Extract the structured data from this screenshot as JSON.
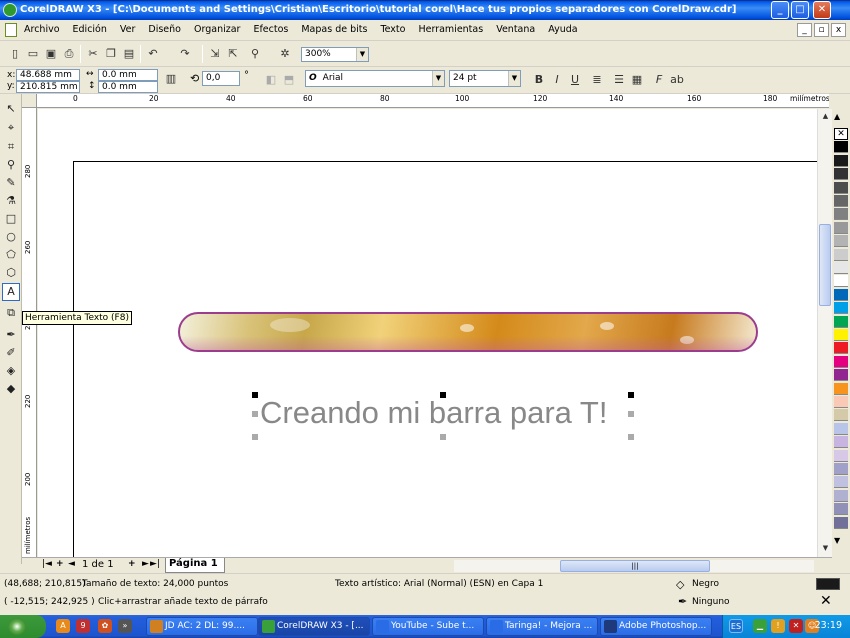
{
  "window": {
    "title": "CorelDRAW X3 - [C:\\Documents and Settings\\Cristian\\Escritorio\\tutorial corel\\Hace tus propios separadores con CorelDraw.cdr]",
    "min": "_",
    "max": "□",
    "close": "✕"
  },
  "menu": [
    "Archivo",
    "Edición",
    "Ver",
    "Diseño",
    "Organizar",
    "Efectos",
    "Mapas de bits",
    "Texto",
    "Herramientas",
    "Ventana",
    "Ayuda"
  ],
  "mdi": {
    "min": "_",
    "restore": "▫",
    "close": "x"
  },
  "standard_toolbar": {
    "zoom": "300%"
  },
  "property_bar": {
    "x_label": "x:",
    "x_value": "48.688 mm",
    "y_label": "y:",
    "y_value": "210.815 mm",
    "w_value": "0.0 mm",
    "h_value": "0.0 mm",
    "angle": "0,0",
    "degree": "°",
    "font": "Arial",
    "size": "24 pt",
    "bold": "B",
    "italic": "I",
    "underline": "U"
  },
  "ruler": {
    "h_ticks": [
      "0",
      "20",
      "40",
      "60",
      "80",
      "100",
      "120",
      "140",
      "160",
      "180"
    ],
    "h_unit": "milímetros",
    "v_ticks": [
      "280",
      "260",
      "240",
      "220",
      "200"
    ],
    "v_unit": "milímetros"
  },
  "canvas": {
    "art_text": "Creando mi barra para T!"
  },
  "tooltip": "Herramienta Texto (F8)",
  "palette": [
    "#ffffff",
    "#000000",
    "#1a1a1a",
    "#333333",
    "#4d4d4d",
    "#666666",
    "#808080",
    "#999999",
    "#b3b3b3",
    "#cccccc",
    "#e6e6e6",
    "#ffffff",
    "#0068b8",
    "#00a0e9",
    "#00a651",
    "#fff200",
    "#ed1c24",
    "#e4007f",
    "#92278f",
    "#f7941d",
    "#f9c9b6",
    "#d4c9a8",
    "#b8c4e8",
    "#c8b4e0",
    "#d8c8e8",
    "#a0a0c8",
    "#c0c0e0",
    "#b0b0d0",
    "#9090b8",
    "#707098"
  ],
  "pagebar": {
    "counter": "1 de 1",
    "page_tab": "Página 1",
    "first": "|◄",
    "prev": "◄",
    "add": "+",
    "next": "►",
    "last": "►|",
    "grip": "|||"
  },
  "status": {
    "coords1": "(48,688; 210,815)",
    "text_size": "Tamaño de texto: 24,000 puntos",
    "object_info": "Texto artístico: Arial (Normal) (ESN) en Capa 1",
    "coords2": "( -12,515; 242,925 )",
    "hint": "Clic+arrastrar añade texto de párrafo",
    "fill": "Negro",
    "outline": "Ninguno"
  },
  "taskbar": {
    "tasks": [
      {
        "label": "JD AC: 2 DL: 99....",
        "color": "#d08020"
      },
      {
        "label": "CorelDRAW X3 - [...",
        "color": "#3aa13a"
      },
      {
        "label": "YouTube - Sube t...",
        "color": "#2a6ce6"
      },
      {
        "label": "Taringa! - Mejora ...",
        "color": "#2a6ce6"
      },
      {
        "label": "Adobe Photoshop...",
        "color": "#1f3a7a"
      }
    ],
    "lang": "ES",
    "clock": "23:19"
  }
}
